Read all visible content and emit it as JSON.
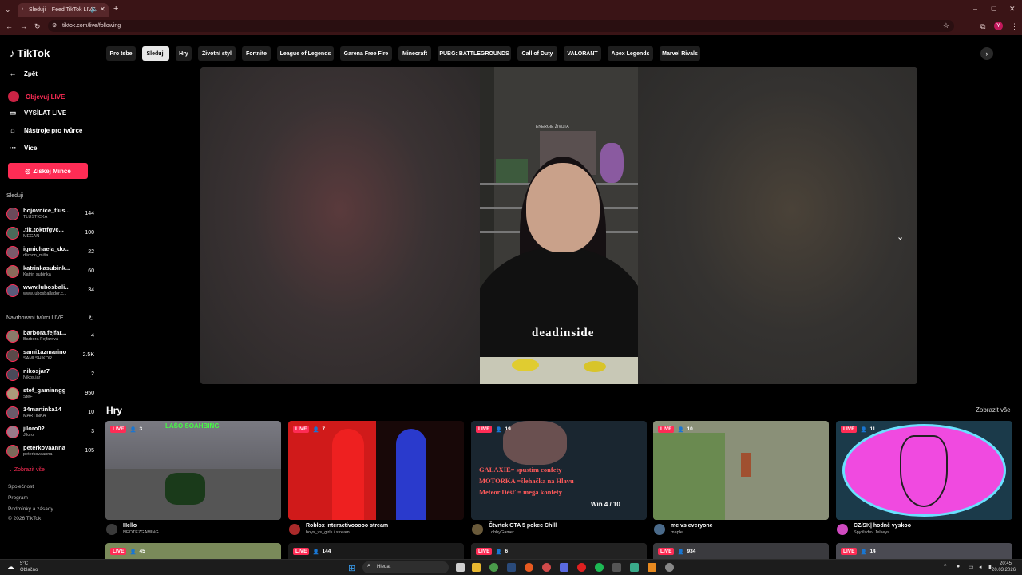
{
  "browser": {
    "tab_title": "Sleduji – Feed TikTok LIVE",
    "url": "tiktok.com/live/following",
    "profile_initial": "Y"
  },
  "sidebar": {
    "logo_text": "TikTok",
    "back_label": "Zpět",
    "nav": [
      {
        "label": "Objevuj LIVE",
        "active": true
      },
      {
        "label": "VYSÍLAT LIVE"
      },
      {
        "label": "Nástroje pro tvůrce"
      },
      {
        "label": "Více"
      }
    ],
    "coins_button": "Získej Mince",
    "following_heading": "Sleduji",
    "following": [
      {
        "name": "bojovnice_tlus...",
        "sub": "TLUSŤIČKA",
        "count": "144"
      },
      {
        "name": ".tik.tokttfgvc...",
        "sub": "MEGAN",
        "count": "100"
      },
      {
        "name": "igmichaela_do...",
        "sub": "démon_miša",
        "count": "22"
      },
      {
        "name": "katrinkasubink...",
        "sub": "Katrin subinka",
        "count": "60"
      },
      {
        "name": "www.lubosbali...",
        "sub": "www.lubosballador.c...",
        "count": "34"
      }
    ],
    "suggested_heading": "Navrhovaní tvůrci LIVE",
    "suggested": [
      {
        "name": "barbora.fejfar...",
        "sub": "Barbora Fejfarová",
        "count": "4"
      },
      {
        "name": "sami1azmarino",
        "sub": "SAMI SHIKOR",
        "count": "2.5K"
      },
      {
        "name": "nikosjar7",
        "sub": "Nikos.jar",
        "count": "2"
      },
      {
        "name": "stef_gaminngg",
        "sub": "SteF",
        "count": "950"
      },
      {
        "name": "14martinka14",
        "sub": "MARTINKA",
        "count": "10"
      },
      {
        "name": "jiloro02",
        "sub": "Jiloro",
        "count": "3"
      },
      {
        "name": "peterkovaanna",
        "sub": "peterkovaanna",
        "count": "105"
      }
    ],
    "show_all": "Zobrazit vše",
    "footer": [
      "Společnost",
      "Program",
      "Podmínky a zásady",
      "© 2026 TikTok"
    ]
  },
  "categories": [
    "Pro tebe",
    "Sleduji",
    "Hry",
    "Životní styl",
    "Fortnite",
    "League of Legends",
    "Garena Free Fire",
    "Minecraft",
    "PUBG: BATTLEGROUNDS",
    "Call of Duty",
    "VALORANT",
    "Apex Legends",
    "Marvel Rivals"
  ],
  "games_section": {
    "title": "Hry",
    "show_all": "Zobrazit vše",
    "cards": [
      {
        "badge": "LIVE",
        "viewers": "3",
        "title": "Hello",
        "user": "NEOTEZGAMING"
      },
      {
        "badge": "LIVE",
        "viewers": "7",
        "title": "Roblox interactivooooo stream",
        "user": "boys_vs_girls / stream"
      },
      {
        "badge": "LIVE",
        "viewers": "19",
        "title": "Čtvrtek GTA 5 pokec Chill",
        "user": "LobbyGamer"
      },
      {
        "badge": "LIVE",
        "viewers": "10",
        "title": "me vs everyone",
        "user": "maple"
      },
      {
        "badge": "LIVE",
        "viewers": "11",
        "title": "CZ/SK| hodně vyskoo",
        "user": "Spyfilsdev Jelseys"
      }
    ],
    "card3_overlay": [
      "GALAXIE= spustím confety",
      "MOTORKA =šlehačka na Hlavu",
      "Meteor Déšť = mega konfety",
      "Win 4 / 10"
    ],
    "card1_overlay": "LAŠO SOAHBIŇG",
    "row2": [
      {
        "badge": "LIVE",
        "viewers": "45"
      },
      {
        "badge": "LIVE",
        "viewers": "144"
      },
      {
        "badge": "LIVE",
        "viewers": "6"
      },
      {
        "badge": "LIVE",
        "viewers": "934"
      },
      {
        "badge": "LIVE",
        "viewers": "14"
      }
    ]
  },
  "stream": {
    "shirt_text": "deadinside",
    "poster_text": "ENERGIE ŽIVOTA"
  },
  "taskbar": {
    "weather_temp": "5°C",
    "weather_desc": "Oblačno",
    "search_placeholder": "Hledat",
    "time": "20:45",
    "date": "20.03.2026"
  },
  "colors": {
    "accent": "#fe2c55",
    "browser_frame": "#3a1416"
  }
}
